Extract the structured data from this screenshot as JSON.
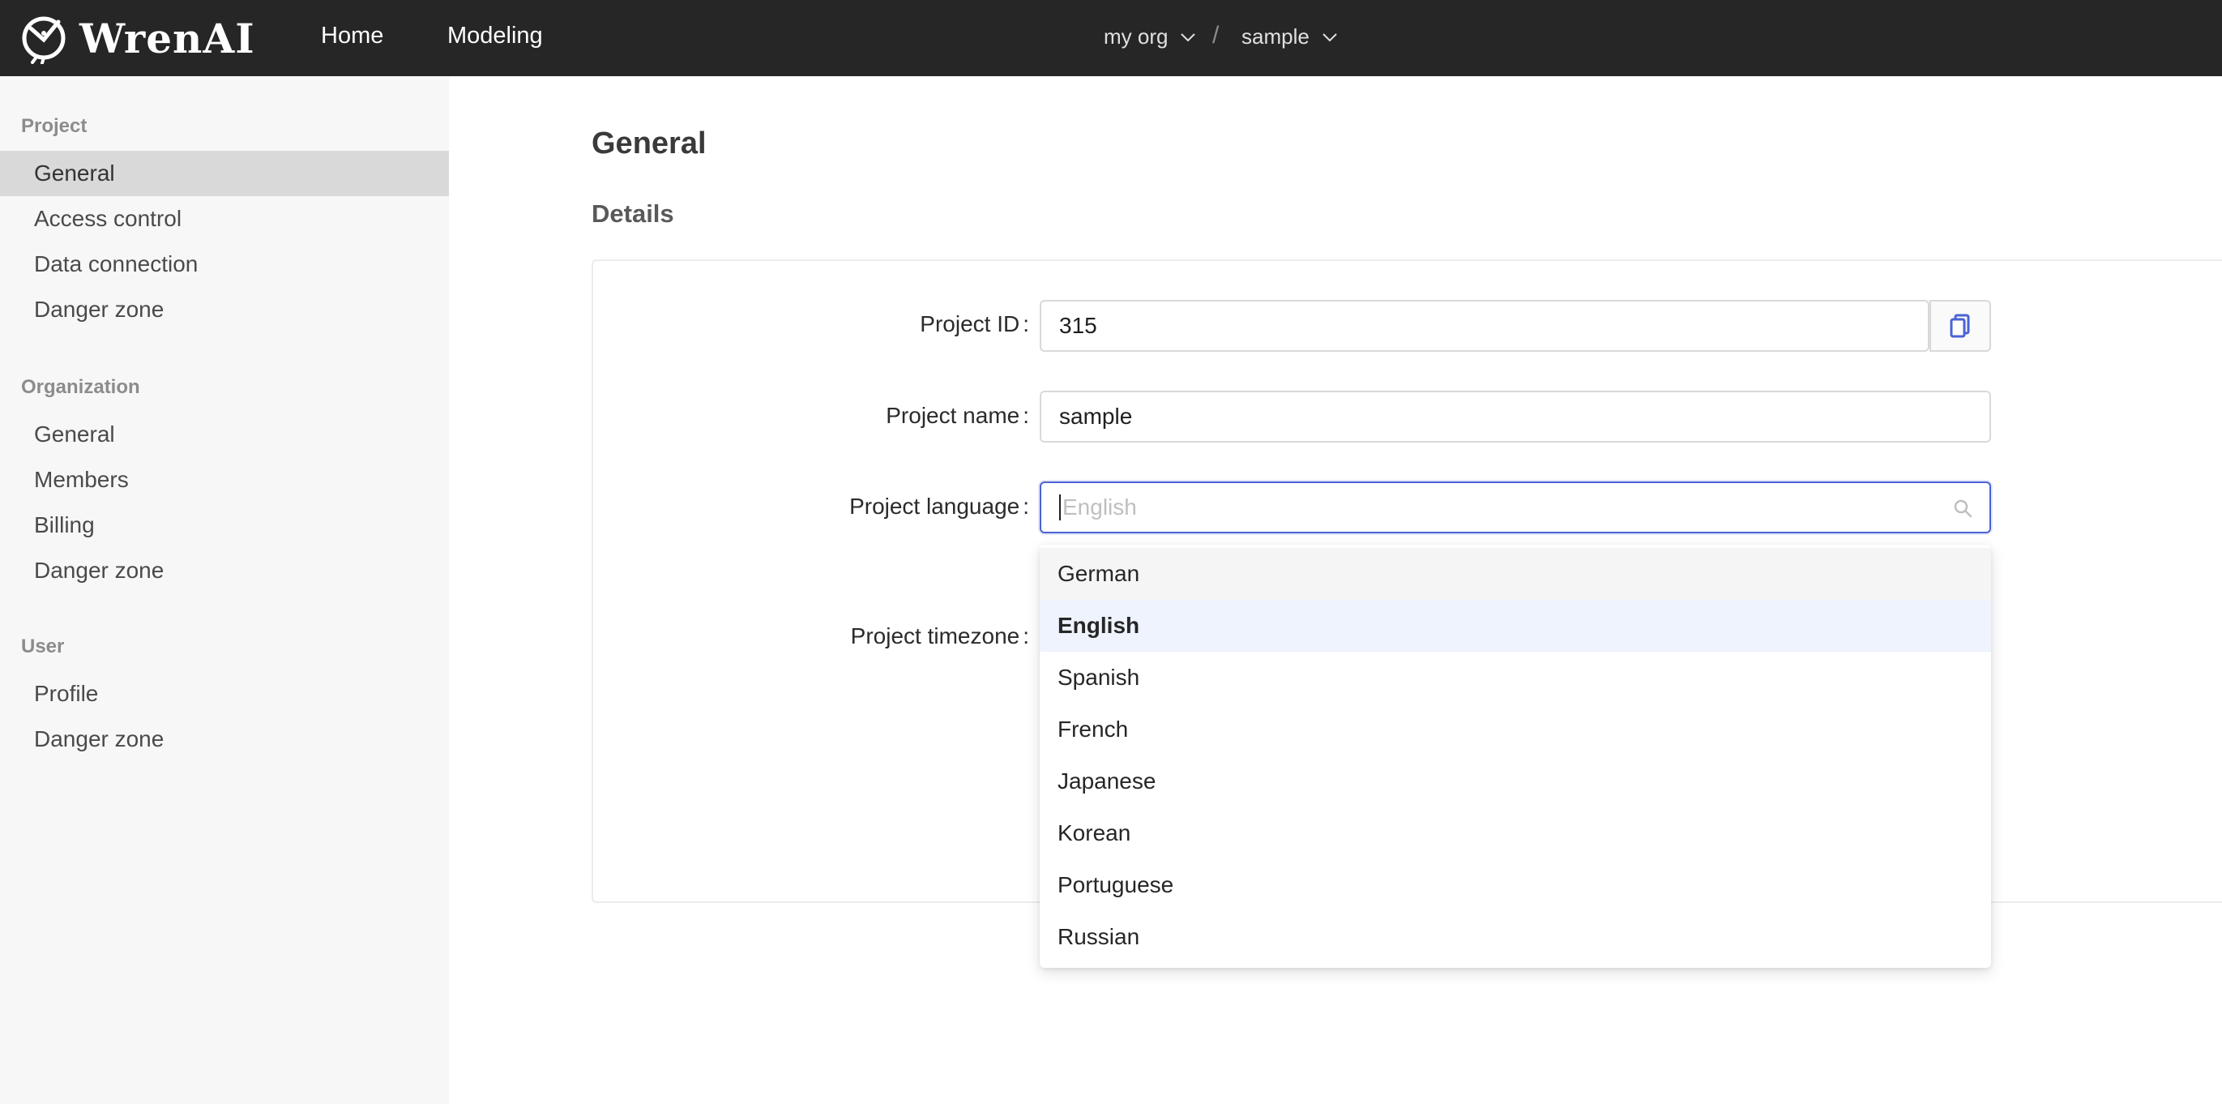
{
  "header": {
    "brand": "WrenAI",
    "nav": [
      {
        "label": "Home"
      },
      {
        "label": "Modeling"
      }
    ],
    "org_switcher": "my org",
    "separator": "/",
    "project_switcher": "sample",
    "background": "#262626"
  },
  "sidebar": {
    "groups": [
      {
        "title": "Project",
        "items": [
          "General",
          "Access control",
          "Data connection",
          "Danger zone"
        ]
      },
      {
        "title": "Organization",
        "items": [
          "General",
          "Members",
          "Billing",
          "Danger zone"
        ]
      },
      {
        "title": "User",
        "items": [
          "Profile",
          "Danger zone"
        ]
      }
    ],
    "active": "Project / General"
  },
  "main": {
    "title": "General",
    "section": "Details",
    "form": {
      "project_id_label": "Project ID",
      "project_id_value": "315",
      "project_name_label": "Project name",
      "project_name_value": "sample",
      "project_language_label": "Project language",
      "project_language_placeholder": "English",
      "project_timezone_label": "Project timezone",
      "label_suffix": ":"
    },
    "language_dropdown": {
      "options": [
        "German",
        "English",
        "Spanish",
        "French",
        "Japanese",
        "Korean",
        "Portuguese",
        "Russian"
      ],
      "selected": "English",
      "hovered": "German"
    }
  },
  "colors": {
    "accent": "#4a63d4",
    "selected_option_bg": "#eef3fd",
    "sidebar_bg": "#f7f7f7",
    "active_item_bg": "#d9d9d9"
  }
}
